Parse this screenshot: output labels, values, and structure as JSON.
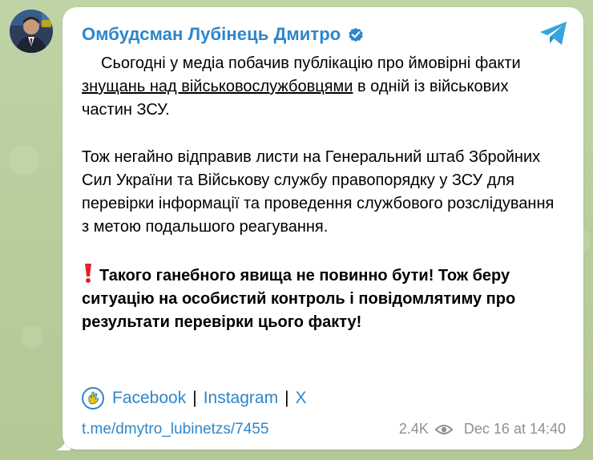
{
  "channel": {
    "name": "Омбудсман Лубінець Дмитро",
    "verified": true
  },
  "post": {
    "p1_text": "Сьогодні у медіа побачив публікацію про ймовірні факти ",
    "p1_link": "знущань над військовослужбовцями",
    "p1_tail": " в одній із військових частин ЗСУ.",
    "p2": "Тож негайно відправив листи на Генеральний штаб Збройних Сил України та Військову службу правопорядку у ЗСУ для перевірки інформації та проведення службового розслідування з метою подальшого реагування.",
    "p3": "Такого ганебного явища не повинно бути! Тож беру ситуацію на особистий контроль і повідомлятиму про результати перевірки цього факту!"
  },
  "social": {
    "facebook": "Facebook",
    "sep1": "|",
    "instagram": "Instagram",
    "sep2": "|",
    "x": "X"
  },
  "footer": {
    "link": "t.me/dmytro_lubinetzs/7455",
    "views": "2.4K",
    "date": "Dec 16 at 14:40"
  },
  "colors": {
    "accent": "#2f86c9",
    "background": "#b9cfa0",
    "meta": "#8a9099",
    "exclamation": "#e0242b"
  },
  "icons": {
    "verified": "verified-badge-icon",
    "share": "telegram-plane-icon",
    "exclamation": "red-exclamation-icon",
    "hand": "hand-emoji-icon",
    "views": "eye-icon"
  }
}
